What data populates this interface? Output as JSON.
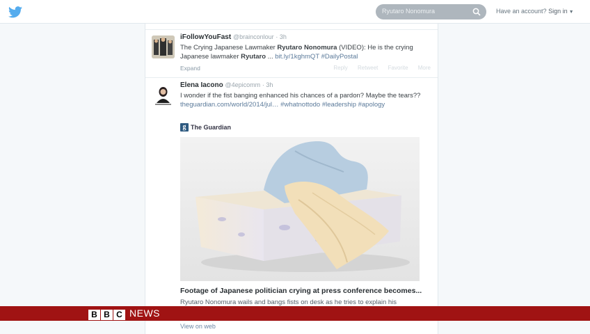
{
  "topbar": {
    "logo_icon": "twitter-bird-icon",
    "search_placeholder": "Ryutaro Nonomura",
    "search_icon": "search-icon",
    "account_prefix": "Have an account?",
    "signin_label": "Sign in"
  },
  "tweets": [
    {
      "name": "iFollowYouFast",
      "handle": "@brainconlour",
      "time": "3h",
      "text_1": "The Crying Japanese Lawmaker ",
      "text_bold_1": "Ryutaro Nonomura",
      "text_2": " (VIDEO): He is the crying Japanese lawmaker ",
      "text_bold_2": "Ryutaro",
      "text_3": " ... ",
      "link": "bit.ly/1kghmQT",
      "hashtag": "#DailyPostal",
      "expand_label": "Expand",
      "actions": [
        "Reply",
        "Retweet",
        "Favorite",
        "More"
      ]
    },
    {
      "name": "Elena Iacono",
      "handle": "@4epicomm",
      "time": "3h",
      "text_1": "I wonder if the fist banging enhanced his chances of a pardon? Maybe the tears?? ",
      "link": "theguardian.com/world/2014/jul…",
      "hashtags": "#whatnottodo #leadership #apology",
      "card": {
        "source": "The Guardian",
        "source_logo_letter": "g",
        "headline": "Footage of Japanese politician crying at press conference becomes...",
        "description": "Ryutaro Nonomura wails and bangs fists on desk as he tries to explain his",
        "view_on_web": "View on web"
      }
    }
  ],
  "bbc": {
    "letters": [
      "B",
      "B",
      "C"
    ],
    "news": "NEWS",
    "bar_color": "#a01313"
  },
  "colors": {
    "accent": "#55acee",
    "link": "#5b7a9a"
  }
}
